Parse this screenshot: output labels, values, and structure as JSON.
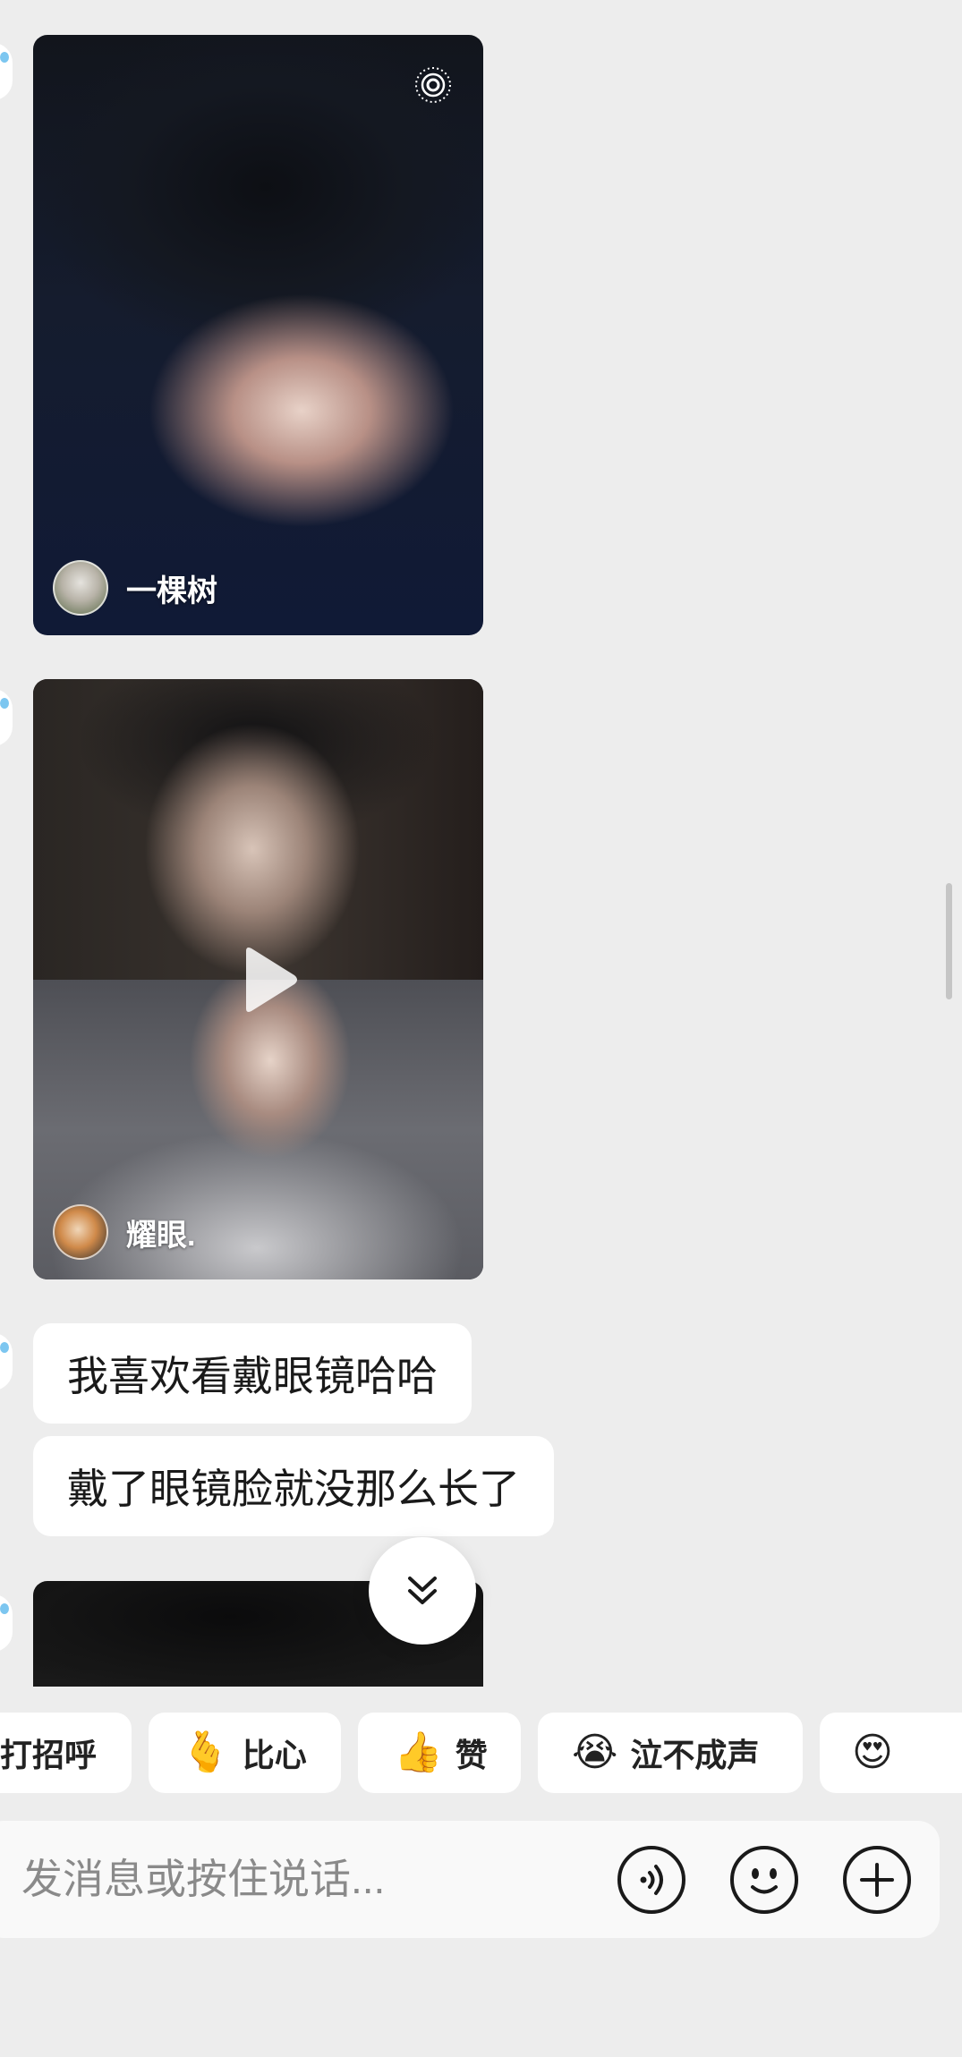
{
  "feed": {
    "cards": [
      {
        "username": "一棵树",
        "kind": "live-photo"
      },
      {
        "username": "耀眼.",
        "kind": "video"
      }
    ],
    "messages": [
      "我喜欢看戴眼镜哈哈",
      "戴了眼镜脸就没那么长了"
    ]
  },
  "quick_replies": [
    {
      "label": "打招呼",
      "emoji": ""
    },
    {
      "label": "比心",
      "emoji": "🫰"
    },
    {
      "label": "赞",
      "emoji": "👍"
    },
    {
      "label": "泣不成声",
      "emoji": "😭"
    },
    {
      "label": "",
      "emoji": "😍"
    }
  ],
  "composer": {
    "placeholder": "发消息或按住说话...",
    "buttons": [
      "voice-icon",
      "emoji-icon",
      "plus-icon"
    ]
  },
  "colors": {
    "background": "#ededed",
    "bubble": "#ffffff",
    "icon": "#1a1a1a"
  }
}
